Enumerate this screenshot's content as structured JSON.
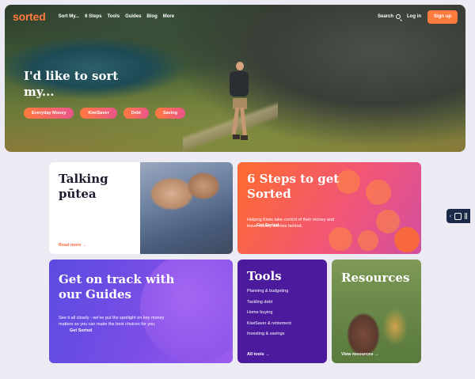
{
  "nav": {
    "logo": "sorted",
    "links": [
      "Sort My...",
      "6 Steps",
      "Tools",
      "Guides",
      "Blog",
      "More"
    ],
    "search_label": "Search",
    "login_label": "Log in",
    "signup_label": "Sign up"
  },
  "hero": {
    "title": "I'd like to sort my...",
    "pills": [
      "Everyday Money",
      "KiwiSaver",
      "Debt",
      "Saving"
    ]
  },
  "cards": {
    "talking": {
      "title": "Talking pūtea",
      "cta": "Read more →"
    },
    "steps": {
      "title": "6 Steps to get Sorted",
      "desc": "Helping Kiwis take control of their money and leave money worries behind.",
      "cta": "Get Sorted"
    },
    "guides": {
      "title": "Get on track with our Guides",
      "desc": "See it all clearly - we've put the spotlight on key money matters so you can make the best choices for you.",
      "cta": "Get Sorted"
    },
    "tools": {
      "title": "Tools",
      "items": [
        "Planning & budgeting",
        "Tackling debt",
        "Home buying",
        "KiwiSaver & retirement",
        "Investing & savings"
      ],
      "cta": "All tools →"
    },
    "resources": {
      "title": "Resources",
      "cta": "View resources →"
    }
  },
  "colors": {
    "brand_orange": "#ff7a3d",
    "brand_purple": "#4c1a9c",
    "pill_gradient_end": "#e9558a"
  }
}
